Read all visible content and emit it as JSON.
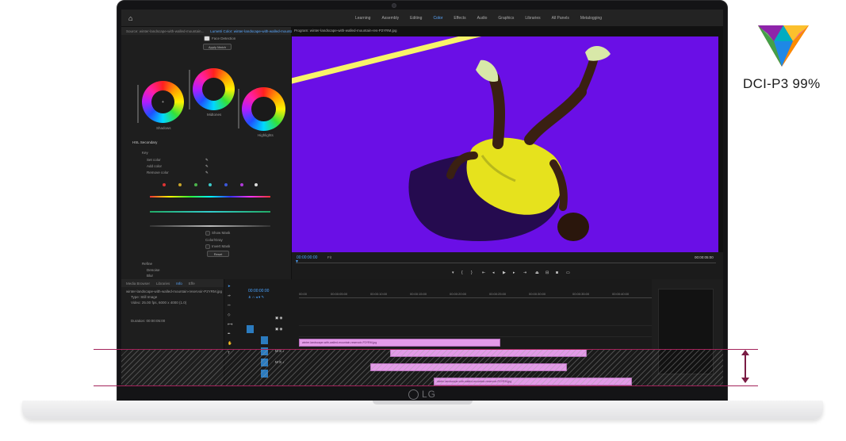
{
  "app": {
    "workspaces": [
      "Learning",
      "Assembly",
      "Editing",
      "Color",
      "Effects",
      "Audio",
      "Graphics",
      "Libraries",
      "All Panels",
      "Metalogging"
    ],
    "active_workspace": "Color"
  },
  "lumetri": {
    "tabs": [
      "Source: winter-landscape-with-walled-mountain...",
      "Lumetri Color: winter-landscape-with-walled-mountain-res..."
    ],
    "face_detection": "Face Detection",
    "apply_match": "Apply Match",
    "wheels": [
      "Shadows",
      "Midtones",
      "Highlights"
    ],
    "hsl_secondary": "HSL Secondary",
    "key": "Key",
    "set_color": "Set color",
    "add_color": "Add color",
    "remove_color": "Remove color",
    "show_mask": "Show Mask",
    "color_gray": "Color/Gray",
    "invert_mask": "Invert Mask",
    "reset": "Reset",
    "refine": "Refine",
    "denoise": "Denoise",
    "blur": "Blur"
  },
  "program": {
    "title": "Program: winter-landscape-with-walled-mountain-res-P2YRM.jpg",
    "timecode_left": "00:00:00:00",
    "fit": "Fit",
    "timecode_right": "00:00:05:00"
  },
  "project": {
    "tabs": [
      "Media Browser",
      "Libraries",
      "Info",
      "Effe"
    ],
    "file_name": "winter-landscape-with-walled-mountain-reservoir-P2YRM.jpg",
    "type": "Type: Still Image",
    "video": "Video: 25.00 fps, 6000 x 4000 (1.0)",
    "duration": "Duration: 00:00:05:00"
  },
  "timeline": {
    "timecode": "00:00:00:00",
    "ruler": [
      "00:00",
      "00:00:05:00",
      "00:00:10:00",
      "00:00:15:00",
      "00:00:20:00",
      "00:00:25:00",
      "00:00:30:00",
      "00:00:35:00",
      "00:00:40:00"
    ],
    "clips": [
      "winter-landscape-with-walled-mountain-reservoir-P2YRM.jpg",
      "winter-landscape-with-walled-mountain-reservoir-P2YRM.jpg"
    ]
  },
  "badge": {
    "text": "DCI-P3 99%"
  },
  "laptop": {
    "logo": "LG"
  },
  "colors": {
    "video_bg": "#6a0fe6",
    "clip": "#e39be8",
    "accent": "#4aa3ff",
    "marker": "#a3235a"
  }
}
